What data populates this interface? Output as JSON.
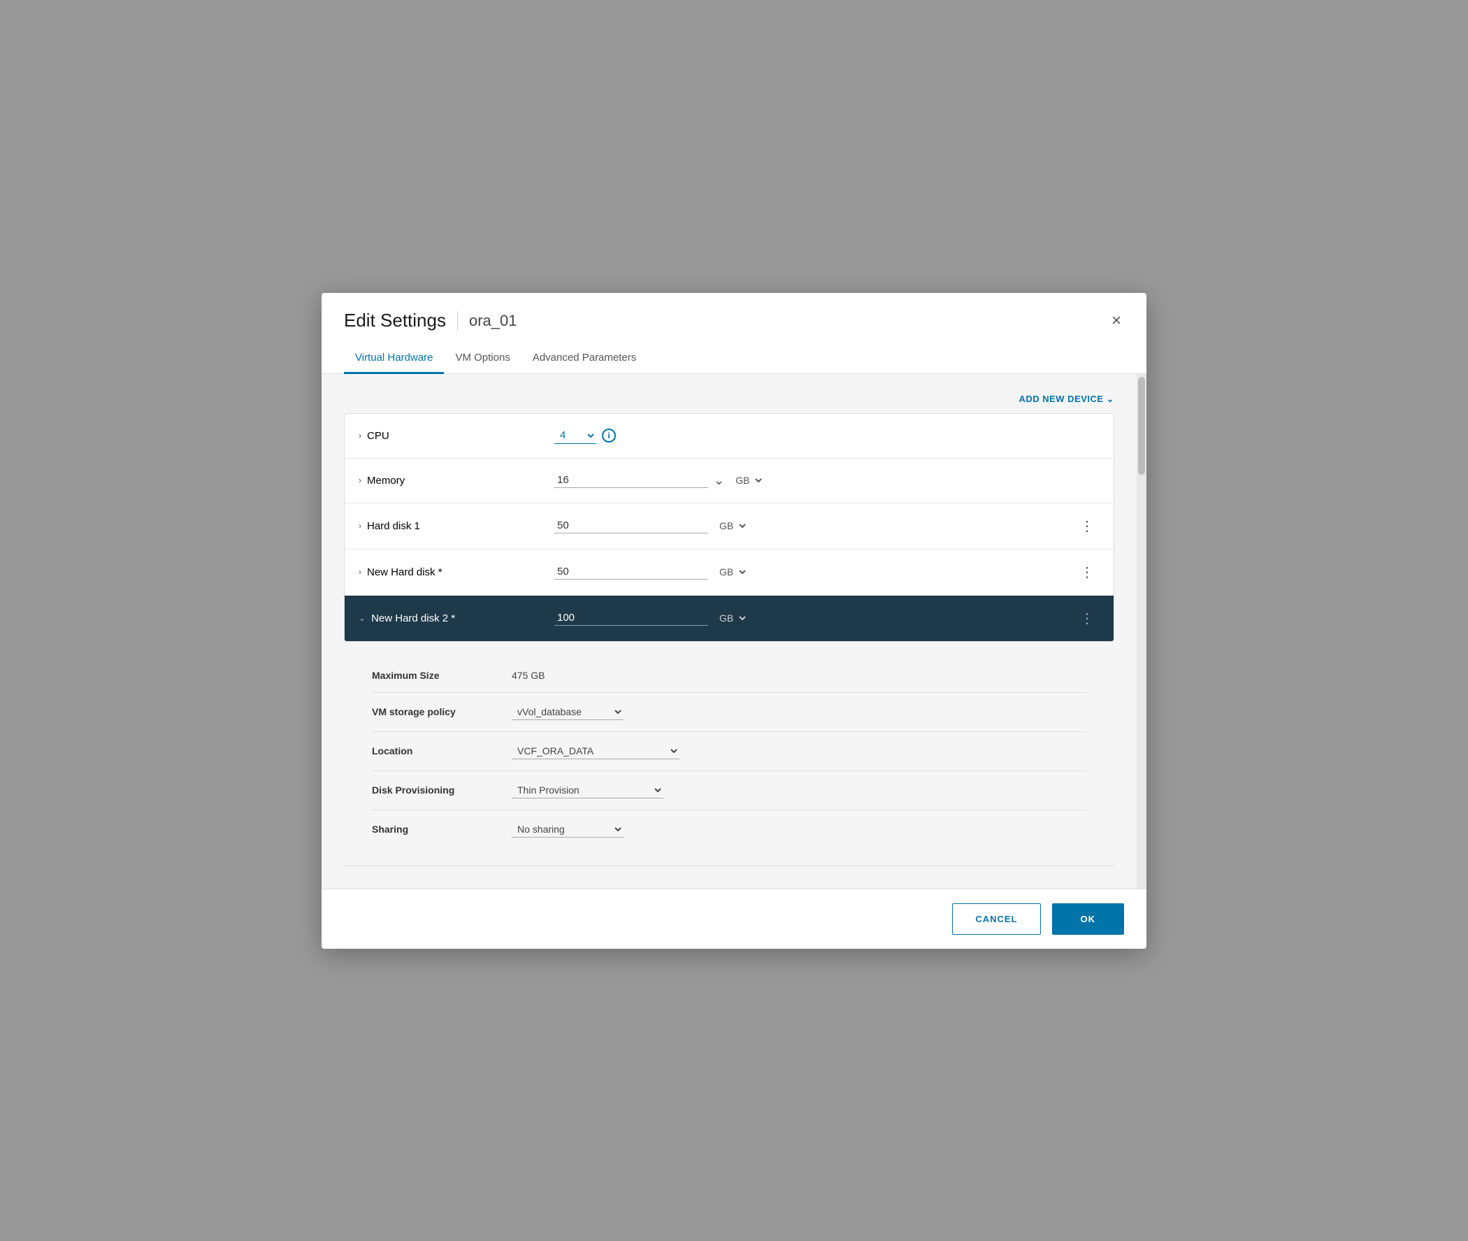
{
  "modal": {
    "title": "Edit Settings",
    "vm_name": "ora_01",
    "close_label": "×"
  },
  "tabs": [
    {
      "id": "virtual-hardware",
      "label": "Virtual Hardware",
      "active": true
    },
    {
      "id": "vm-options",
      "label": "VM Options",
      "active": false
    },
    {
      "id": "advanced-parameters",
      "label": "Advanced Parameters",
      "active": false
    }
  ],
  "toolbar": {
    "add_device_label": "ADD NEW DEVICE"
  },
  "hardware": {
    "rows": [
      {
        "id": "cpu",
        "label": "CPU",
        "value": "4",
        "unit": "",
        "type": "cpu",
        "expanded": false
      },
      {
        "id": "memory",
        "label": "Memory",
        "value": "16",
        "unit": "GB",
        "type": "memory",
        "expanded": false
      },
      {
        "id": "hard-disk-1",
        "label": "Hard disk 1",
        "value": "50",
        "unit": "GB",
        "type": "disk",
        "expanded": false
      },
      {
        "id": "new-hard-disk",
        "label": "New Hard disk *",
        "value": "50",
        "unit": "GB",
        "type": "disk",
        "expanded": false
      },
      {
        "id": "new-hard-disk-2",
        "label": "New Hard disk 2 *",
        "value": "100",
        "unit": "GB",
        "type": "disk",
        "expanded": true
      }
    ]
  },
  "expanded_disk": {
    "maximum_size_label": "Maximum Size",
    "maximum_size_value": "475 GB",
    "vm_storage_policy_label": "VM storage policy",
    "vm_storage_policy_value": "vVol_database",
    "location_label": "Location",
    "location_value": "VCF_ORA_DATA",
    "disk_provisioning_label": "Disk Provisioning",
    "disk_provisioning_value": "Thin Provision",
    "sharing_label": "Sharing",
    "sharing_value": "No sharing"
  },
  "footer": {
    "cancel_label": "CANCEL",
    "ok_label": "OK"
  },
  "icons": {
    "chevron_right": "›",
    "chevron_down": "∨",
    "close": "✕",
    "info": "i",
    "three_dot": "⋮",
    "dropdown": "∨"
  }
}
